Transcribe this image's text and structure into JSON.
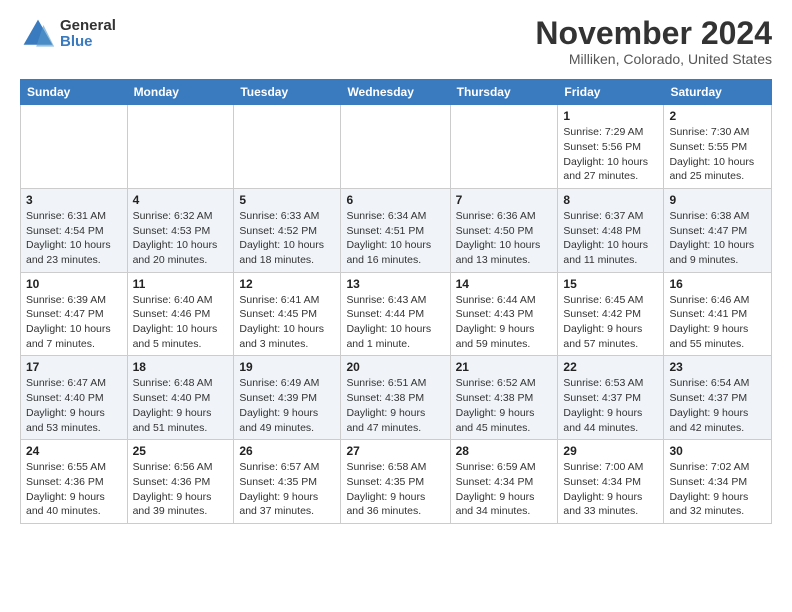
{
  "logo": {
    "general": "General",
    "blue": "Blue"
  },
  "title": {
    "month": "November 2024",
    "location": "Milliken, Colorado, United States"
  },
  "headers": [
    "Sunday",
    "Monday",
    "Tuesday",
    "Wednesday",
    "Thursday",
    "Friday",
    "Saturday"
  ],
  "weeks": [
    [
      {
        "day": "",
        "info": ""
      },
      {
        "day": "",
        "info": ""
      },
      {
        "day": "",
        "info": ""
      },
      {
        "day": "",
        "info": ""
      },
      {
        "day": "",
        "info": ""
      },
      {
        "day": "1",
        "info": "Sunrise: 7:29 AM\nSunset: 5:56 PM\nDaylight: 10 hours and 27 minutes."
      },
      {
        "day": "2",
        "info": "Sunrise: 7:30 AM\nSunset: 5:55 PM\nDaylight: 10 hours and 25 minutes."
      }
    ],
    [
      {
        "day": "3",
        "info": "Sunrise: 6:31 AM\nSunset: 4:54 PM\nDaylight: 10 hours and 23 minutes."
      },
      {
        "day": "4",
        "info": "Sunrise: 6:32 AM\nSunset: 4:53 PM\nDaylight: 10 hours and 20 minutes."
      },
      {
        "day": "5",
        "info": "Sunrise: 6:33 AM\nSunset: 4:52 PM\nDaylight: 10 hours and 18 minutes."
      },
      {
        "day": "6",
        "info": "Sunrise: 6:34 AM\nSunset: 4:51 PM\nDaylight: 10 hours and 16 minutes."
      },
      {
        "day": "7",
        "info": "Sunrise: 6:36 AM\nSunset: 4:50 PM\nDaylight: 10 hours and 13 minutes."
      },
      {
        "day": "8",
        "info": "Sunrise: 6:37 AM\nSunset: 4:48 PM\nDaylight: 10 hours and 11 minutes."
      },
      {
        "day": "9",
        "info": "Sunrise: 6:38 AM\nSunset: 4:47 PM\nDaylight: 10 hours and 9 minutes."
      }
    ],
    [
      {
        "day": "10",
        "info": "Sunrise: 6:39 AM\nSunset: 4:47 PM\nDaylight: 10 hours and 7 minutes."
      },
      {
        "day": "11",
        "info": "Sunrise: 6:40 AM\nSunset: 4:46 PM\nDaylight: 10 hours and 5 minutes."
      },
      {
        "day": "12",
        "info": "Sunrise: 6:41 AM\nSunset: 4:45 PM\nDaylight: 10 hours and 3 minutes."
      },
      {
        "day": "13",
        "info": "Sunrise: 6:43 AM\nSunset: 4:44 PM\nDaylight: 10 hours and 1 minute."
      },
      {
        "day": "14",
        "info": "Sunrise: 6:44 AM\nSunset: 4:43 PM\nDaylight: 9 hours and 59 minutes."
      },
      {
        "day": "15",
        "info": "Sunrise: 6:45 AM\nSunset: 4:42 PM\nDaylight: 9 hours and 57 minutes."
      },
      {
        "day": "16",
        "info": "Sunrise: 6:46 AM\nSunset: 4:41 PM\nDaylight: 9 hours and 55 minutes."
      }
    ],
    [
      {
        "day": "17",
        "info": "Sunrise: 6:47 AM\nSunset: 4:40 PM\nDaylight: 9 hours and 53 minutes."
      },
      {
        "day": "18",
        "info": "Sunrise: 6:48 AM\nSunset: 4:40 PM\nDaylight: 9 hours and 51 minutes."
      },
      {
        "day": "19",
        "info": "Sunrise: 6:49 AM\nSunset: 4:39 PM\nDaylight: 9 hours and 49 minutes."
      },
      {
        "day": "20",
        "info": "Sunrise: 6:51 AM\nSunset: 4:38 PM\nDaylight: 9 hours and 47 minutes."
      },
      {
        "day": "21",
        "info": "Sunrise: 6:52 AM\nSunset: 4:38 PM\nDaylight: 9 hours and 45 minutes."
      },
      {
        "day": "22",
        "info": "Sunrise: 6:53 AM\nSunset: 4:37 PM\nDaylight: 9 hours and 44 minutes."
      },
      {
        "day": "23",
        "info": "Sunrise: 6:54 AM\nSunset: 4:37 PM\nDaylight: 9 hours and 42 minutes."
      }
    ],
    [
      {
        "day": "24",
        "info": "Sunrise: 6:55 AM\nSunset: 4:36 PM\nDaylight: 9 hours and 40 minutes."
      },
      {
        "day": "25",
        "info": "Sunrise: 6:56 AM\nSunset: 4:36 PM\nDaylight: 9 hours and 39 minutes."
      },
      {
        "day": "26",
        "info": "Sunrise: 6:57 AM\nSunset: 4:35 PM\nDaylight: 9 hours and 37 minutes."
      },
      {
        "day": "27",
        "info": "Sunrise: 6:58 AM\nSunset: 4:35 PM\nDaylight: 9 hours and 36 minutes."
      },
      {
        "day": "28",
        "info": "Sunrise: 6:59 AM\nSunset: 4:34 PM\nDaylight: 9 hours and 34 minutes."
      },
      {
        "day": "29",
        "info": "Sunrise: 7:00 AM\nSunset: 4:34 PM\nDaylight: 9 hours and 33 minutes."
      },
      {
        "day": "30",
        "info": "Sunrise: 7:02 AM\nSunset: 4:34 PM\nDaylight: 9 hours and 32 minutes."
      }
    ]
  ]
}
